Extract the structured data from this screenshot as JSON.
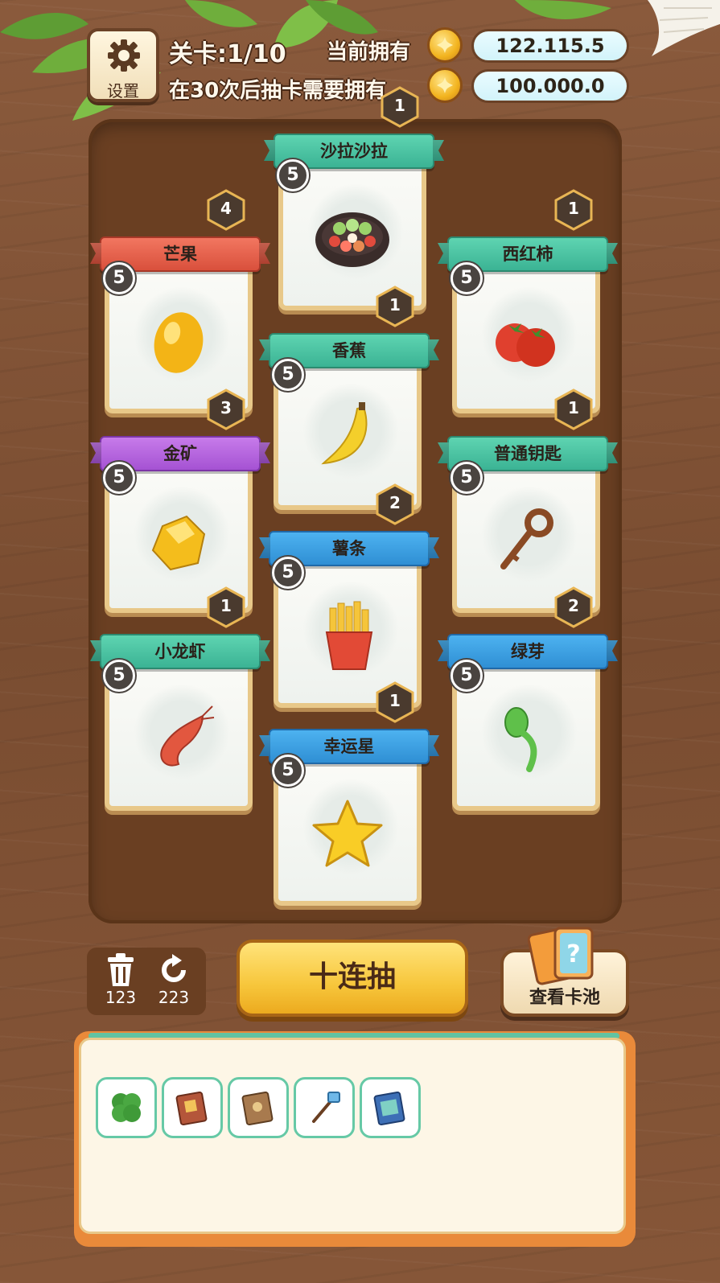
{
  "settings": {
    "label": "设置"
  },
  "level": {
    "text": "关卡:1/10"
  },
  "currency": {
    "owned_label": "当前拥有",
    "owned_value": "122.115.5",
    "required_label": "在30次后抽卡需要拥有",
    "required_value": "100.000.0"
  },
  "cards": [
    {
      "name": "沙拉沙拉",
      "level": "5",
      "count": "1",
      "banner": "green",
      "icon": "salad-icon"
    },
    {
      "name": "芒果",
      "level": "5",
      "count": "4",
      "banner": "red",
      "icon": "mango-icon"
    },
    {
      "name": "西红柿",
      "level": "5",
      "count": "1",
      "banner": "green",
      "icon": "tomato-icon"
    },
    {
      "name": "香蕉",
      "level": "5",
      "count": "1",
      "banner": "green",
      "icon": "banana-icon"
    },
    {
      "name": "金矿",
      "level": "5",
      "count": "3",
      "banner": "purple",
      "icon": "gold-ore-icon"
    },
    {
      "name": "普通钥匙",
      "level": "5",
      "count": "1",
      "banner": "green",
      "icon": "key-icon"
    },
    {
      "name": "薯条",
      "level": "5",
      "count": "2",
      "banner": "blue",
      "icon": "fries-icon"
    },
    {
      "name": "小龙虾",
      "level": "5",
      "count": "1",
      "banner": "green",
      "icon": "crayfish-icon"
    },
    {
      "name": "绿芽",
      "level": "5",
      "count": "2",
      "banner": "blue",
      "icon": "sprout-icon"
    },
    {
      "name": "幸运星",
      "level": "5",
      "count": "1",
      "banner": "blue",
      "icon": "star-icon"
    }
  ],
  "tools": {
    "trash_count": "123",
    "refresh_count": "223"
  },
  "draw_button": {
    "label": "十连抽"
  },
  "pool_button": {
    "label": "查看卡池"
  },
  "inventory": {
    "items": [
      "clover-icon",
      "book-red-icon",
      "book-brown-icon",
      "magic-wand-icon",
      "book-blue-icon"
    ]
  }
}
